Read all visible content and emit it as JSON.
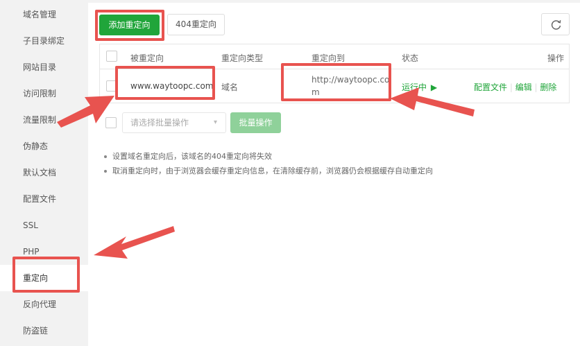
{
  "sidebar": {
    "items": [
      {
        "label": "域名管理"
      },
      {
        "label": "子目录绑定"
      },
      {
        "label": "网站目录"
      },
      {
        "label": "访问限制"
      },
      {
        "label": "流量限制"
      },
      {
        "label": "伪静态"
      },
      {
        "label": "默认文档"
      },
      {
        "label": "配置文件"
      },
      {
        "label": "SSL"
      },
      {
        "label": "PHP"
      },
      {
        "label": "重定向"
      },
      {
        "label": "反向代理"
      },
      {
        "label": "防盗链"
      }
    ],
    "active": "重定向"
  },
  "toolbar": {
    "add_label": "添加重定向",
    "redirect404_label": "404重定向",
    "refresh_icon": "refresh-icon"
  },
  "table": {
    "headers": [
      "被重定向",
      "重定向类型",
      "重定向到",
      "状态",
      "操作"
    ],
    "rows": [
      {
        "source": "www.waytoopc.com",
        "type": "域名",
        "target_line1": "http://waytoopc.co",
        "target_line2": "m",
        "status": "运行中",
        "actions": [
          "配置文件",
          "编辑",
          "删除"
        ]
      }
    ]
  },
  "batch": {
    "placeholder": "请选择批量操作",
    "button_label": "批量操作"
  },
  "tips": [
    "设置域名重定向后，该域名的404重定向将失效",
    "取消重定向时，由于浏览器会缓存重定向信息，在清除缓存前，浏览器仍会根据缓存自动重定向"
  ],
  "colors": {
    "accent": "#20a53a",
    "annotation": "#e8534f",
    "sidebar_bg": "#f2f2f2"
  }
}
